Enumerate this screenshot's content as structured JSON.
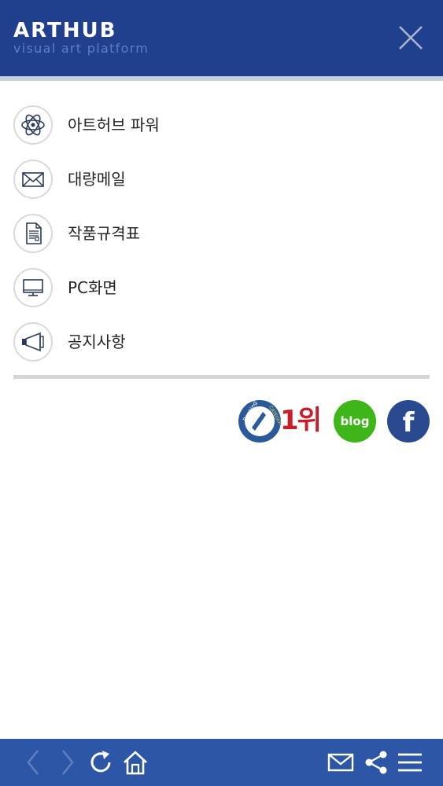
{
  "header": {
    "logo": "ARTHUB",
    "tagline": "visual art platform",
    "close_icon": "close-icon"
  },
  "menu": {
    "items": [
      {
        "label": "아트허브 파워",
        "icon": "atom-icon"
      },
      {
        "label": "대량메일",
        "icon": "envelope-icon"
      },
      {
        "label": "작품규격표",
        "icon": "document-icon"
      },
      {
        "label": "PC화면",
        "icon": "monitor-icon"
      },
      {
        "label": "공지사항",
        "icon": "megaphone-icon"
      }
    ]
  },
  "social": {
    "ranking_badge_text": "1위",
    "ranking_seal_top": "Ranking",
    "ranking_seal_bottom": "CATEGORY",
    "blog_label": "blog",
    "facebook_label": "f",
    "colors": {
      "ranking_red": "#c81e2a",
      "blog_green": "#3fb618",
      "facebook_blue": "#2a4a8f"
    }
  },
  "bottom_bar": {
    "icons": [
      "back-arrow-icon",
      "forward-arrow-icon",
      "refresh-icon",
      "home-icon",
      "mail-icon",
      "share-icon",
      "menu-icon"
    ]
  },
  "colors": {
    "header_bg": "#203f8c",
    "tagline": "#5c7fc4",
    "bottom_bar_bg": "#2e56a6"
  }
}
